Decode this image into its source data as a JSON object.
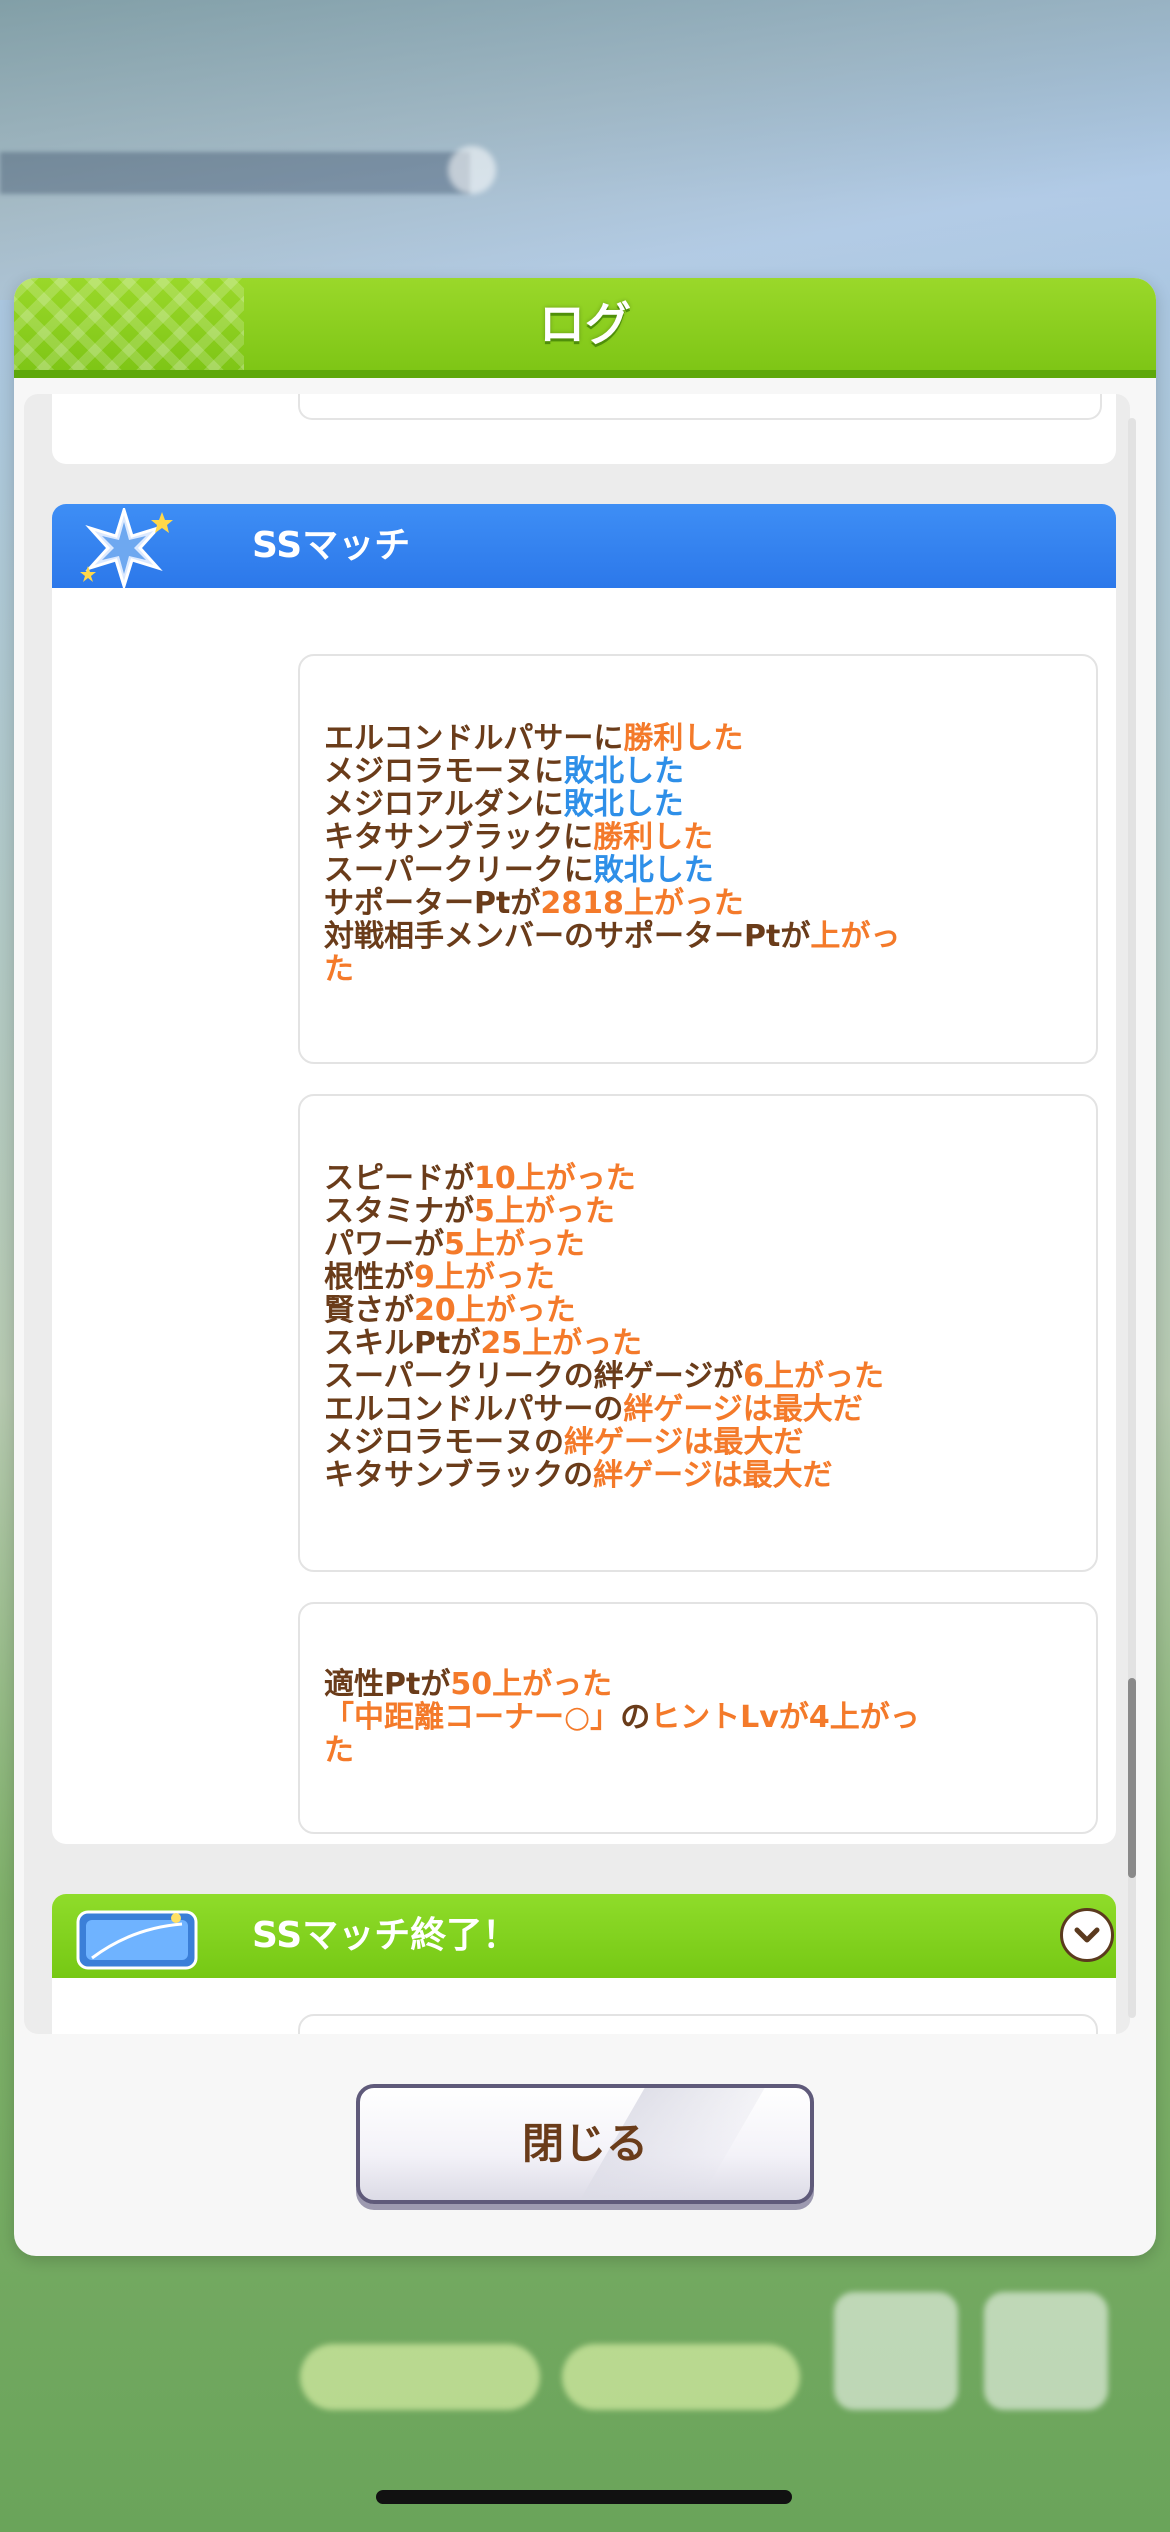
{
  "modal": {
    "title": "ログ",
    "close_label": "閉じる"
  },
  "sections": [
    {
      "title": "SSマッチ",
      "cards": [
        [
          [
            {
              "t": "エルコンドルパサーに",
              "c": "n"
            },
            {
              "t": "勝利した",
              "c": "o"
            }
          ],
          [
            {
              "t": "メジロラモーヌに",
              "c": "n"
            },
            {
              "t": "敗北した",
              "c": "b"
            }
          ],
          [
            {
              "t": "メジロアルダンに",
              "c": "n"
            },
            {
              "t": "敗北した",
              "c": "b"
            }
          ],
          [
            {
              "t": "キタサンブラックに",
              "c": "n"
            },
            {
              "t": "勝利した",
              "c": "o"
            }
          ],
          [
            {
              "t": "スーパークリークに",
              "c": "n"
            },
            {
              "t": "敗北した",
              "c": "b"
            }
          ],
          [
            {
              "t": "サポーターPtが",
              "c": "n"
            },
            {
              "t": "2818上がった",
              "c": "o"
            }
          ],
          [
            {
              "t": "対戦相手メンバーのサポーターPtが",
              "c": "n"
            },
            {
              "t": "上がっ",
              "c": "o"
            }
          ],
          [
            {
              "t": "た",
              "c": "o"
            }
          ]
        ],
        [
          [
            {
              "t": "スピードが",
              "c": "n"
            },
            {
              "t": "10上がった",
              "c": "o"
            }
          ],
          [
            {
              "t": "スタミナが",
              "c": "n"
            },
            {
              "t": "5上がった",
              "c": "o"
            }
          ],
          [
            {
              "t": "パワーが",
              "c": "n"
            },
            {
              "t": "5上がった",
              "c": "o"
            }
          ],
          [
            {
              "t": "根性が",
              "c": "n"
            },
            {
              "t": "9上がった",
              "c": "o"
            }
          ],
          [
            {
              "t": "賢さが",
              "c": "n"
            },
            {
              "t": "20上がった",
              "c": "o"
            }
          ],
          [
            {
              "t": "スキルPtが",
              "c": "n"
            },
            {
              "t": "25上がった",
              "c": "o"
            }
          ],
          [
            {
              "t": "スーパークリークの絆ゲージが",
              "c": "n"
            },
            {
              "t": "6上がった",
              "c": "o"
            }
          ],
          [
            {
              "t": "エルコンドルパサーの",
              "c": "n"
            },
            {
              "t": "絆ゲージは最大だ",
              "c": "o"
            }
          ],
          [
            {
              "t": "メジロラモーヌの",
              "c": "n"
            },
            {
              "t": "絆ゲージは最大だ",
              "c": "o"
            }
          ],
          [
            {
              "t": "キタサンブラックの",
              "c": "n"
            },
            {
              "t": "絆ゲージは最大だ",
              "c": "o"
            }
          ]
        ],
        [
          [
            {
              "t": "適性Ptが",
              "c": "n"
            },
            {
              "t": "50上がった",
              "c": "o"
            }
          ],
          [
            {
              "t": "「中距離コーナー○」",
              "c": "o"
            },
            {
              "t": "の",
              "c": "n"
            },
            {
              "t": "ヒントLvが4上がっ",
              "c": "o"
            }
          ],
          [
            {
              "t": "た",
              "c": "o"
            }
          ]
        ]
      ]
    },
    {
      "title": "SSマッチ終了！"
    }
  ],
  "colors": {
    "normal_text": "#6a3c1a",
    "orange_text": "#f47a2a",
    "blue_text": "#2e8fe8",
    "header_green": "#7cc414",
    "header_blue": "#2c78ea"
  },
  "icons": [
    "snowflake-star-icon",
    "project-larc-logo",
    "chevron-down-icon"
  ]
}
